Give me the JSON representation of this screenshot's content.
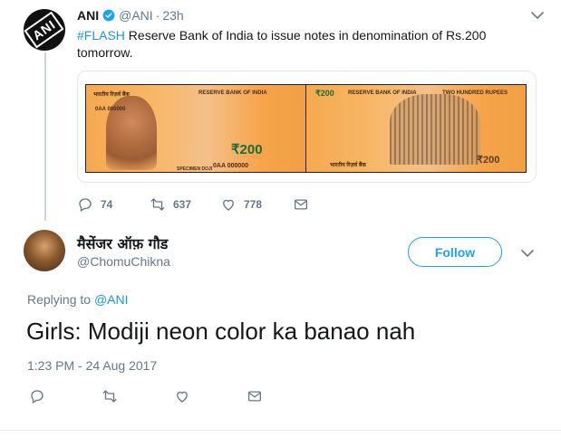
{
  "parent_tweet": {
    "name": "ANI",
    "handle": "@ANI",
    "dot": "·",
    "time": "23h",
    "avatar_logo": "ANI",
    "hashtag": "#FLASH",
    "text": " Reserve Bank of India to issue notes in denomination of Rs.200 tomorrow.",
    "media": {
      "front_labels": {
        "hindi_title": "भारतीय रिज़र्व बैंक",
        "english_title": "RESERVE BANK OF INDIA",
        "serial_top": "0AA 000000",
        "serial_bottom": "0AA 000000",
        "value": "₹200",
        "sign": "SPECIMEN DOJI"
      },
      "back_labels": {
        "value": "₹200",
        "header": "RESERVE BANK OF INDIA",
        "words": "TWO HUNDRED RUPEES",
        "corner_value": "₹200",
        "slogan": "भारतीय रिज़र्व बैंक"
      }
    },
    "actions": {
      "replies": "74",
      "retweets": "637",
      "likes": "778"
    }
  },
  "reply_tweet": {
    "name": "मैसेंजर ऑफ़ गौड",
    "handle": "@ChomuChikna",
    "follow_label": "Follow",
    "replying_prefix": "Replying to ",
    "replying_to": "@ANI",
    "text": "Girls: Modiji neon color ka banao nah",
    "timestamp": "1:23 PM - 24 Aug 2017"
  },
  "colors": {
    "accent": "#1da1f2",
    "link": "#1b95e0",
    "secondary_text": "#657786",
    "border": "#e1e8ed"
  }
}
